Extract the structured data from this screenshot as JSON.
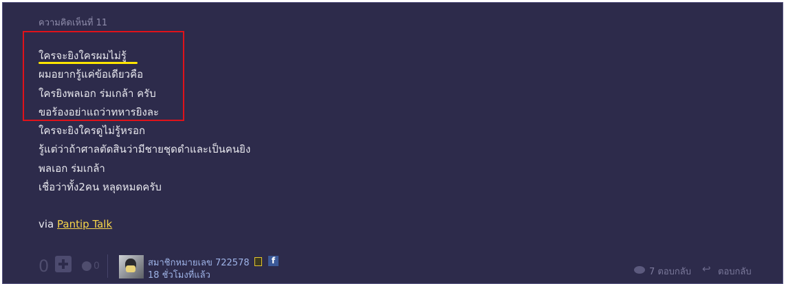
{
  "comment": {
    "header": "ความคิดเห็นที่ 11",
    "lines": [
      "ใครจะยิงใครผมไม่รู้",
      "ผมอยากรู้แค่ข้อเดียวคือ",
      "ใครยิงพลเอก ร่มเกล้า ครับ",
      "ขอร้องอย่าแถว่าทหารยิงละ",
      "ใครจะยิงใครดูไม่รู้หรอก",
      "รู้แต่ว่าถ้าศาลตัดสินว่ามีชายชุดดำและเป็นคนยิง",
      "พลเอก ร่มเกล้า",
      "เชื่อว่าทั้ง2คน หลุดหมดครับ"
    ],
    "via_prefix": "via",
    "via_link": "Pantip Talk"
  },
  "footer": {
    "vote_count": "0",
    "emotion_count": "0",
    "username": "สมาชิกหมายเลข 722578",
    "timestamp": "18 ชั่วโมงที่แล้ว",
    "replies_label": "7 ตอบกลับ",
    "reply_label": "ตอบกลับ",
    "fb_letter": "f"
  },
  "colors": {
    "background": "#2d2b4b",
    "link": "#f7d54a",
    "highlight_box": "#e0121a",
    "underline_mark": "#ffe600",
    "username": "#9fb4e8"
  },
  "icons": [
    "plus-icon",
    "emotion-icon",
    "member-badge-icon",
    "facebook-icon",
    "replies-icon",
    "reply-arrow-icon"
  ]
}
